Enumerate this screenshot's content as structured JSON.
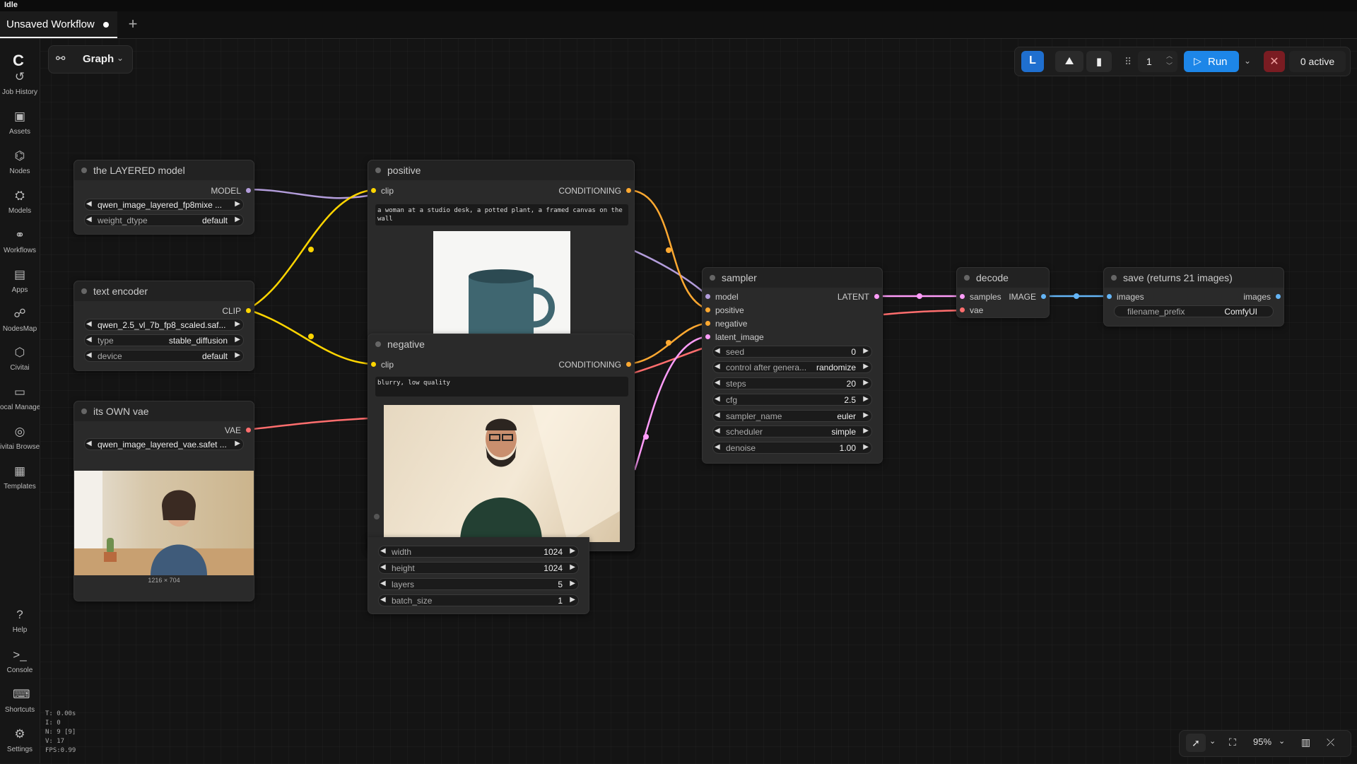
{
  "status": {
    "state": "Idle"
  },
  "tabs": [
    {
      "label": "Unsaved Workflow",
      "modified": true
    }
  ],
  "new_tab_icon": "+",
  "sidebar": {
    "logo": "C",
    "items": [
      {
        "label": "Job History",
        "icon": "↺"
      },
      {
        "label": "Assets",
        "icon": "▣"
      },
      {
        "label": "Nodes",
        "icon": "⌬"
      },
      {
        "label": "Models",
        "icon": "⛭"
      },
      {
        "label": "Workflows",
        "icon": "⚭"
      },
      {
        "label": "Apps",
        "icon": "▤"
      },
      {
        "label": "NodesMap",
        "icon": "☍"
      },
      {
        "label": "Civitai",
        "icon": "⬡"
      },
      {
        "label": "ocal Manage",
        "icon": "▭"
      },
      {
        "label": "ivitai Browse",
        "icon": "◎"
      },
      {
        "label": "Templates",
        "icon": "▦"
      }
    ],
    "bottom_items": [
      {
        "label": "Help",
        "icon": "?"
      },
      {
        "label": "Console",
        "icon": ">_"
      },
      {
        "label": "Shortcuts",
        "icon": "⌨"
      },
      {
        "label": "Settings",
        "icon": "⚙"
      }
    ]
  },
  "graph_mode": {
    "label": "Graph"
  },
  "toolbar": {
    "l_label": "L",
    "queue_count": "1",
    "run_label": "Run",
    "cancel_icon": "✕",
    "active_label": "0 active"
  },
  "nodes": {
    "model": {
      "title": "the LAYERED model",
      "output": "MODEL",
      "widgets": {
        "unet_name": "qwen_image_layered_fp8mixe ...",
        "weight_dtype_label": "weight_dtype",
        "weight_dtype": "default"
      }
    },
    "text_encoder": {
      "title": "text encoder",
      "output": "CLIP",
      "widgets": {
        "clip_name": "qwen_2.5_vl_7b_fp8_scaled.saf...",
        "type_label": "type",
        "type": "stable_diffusion",
        "device_label": "device",
        "device": "default"
      }
    },
    "vae": {
      "title": "its OWN vae",
      "output": "VAE",
      "widgets": {
        "vae_name": "qwen_image_layered_vae.safet ..."
      },
      "image_size": "1216 × 704"
    },
    "positive": {
      "title": "positive",
      "input": "clip",
      "output": "CONDITIONING",
      "text": "a woman at a studio desk, a potted plant, a framed canvas on the wall"
    },
    "negative": {
      "title": "negative",
      "input": "clip",
      "output": "CONDITIONING",
      "text": "blurry, low quality"
    },
    "latent": {
      "widgets": [
        {
          "name": "width",
          "value": "1024"
        },
        {
          "name": "height",
          "value": "1024"
        },
        {
          "name": "layers",
          "value": "5"
        },
        {
          "name": "batch_size",
          "value": "1"
        }
      ]
    },
    "sampler": {
      "title": "sampler",
      "inputs": [
        "model",
        "positive",
        "negative",
        "latent_image"
      ],
      "output": "LATENT",
      "widgets": [
        {
          "name": "seed",
          "value": "0"
        },
        {
          "name": "control after genera...",
          "value": "randomize"
        },
        {
          "name": "steps",
          "value": "20"
        },
        {
          "name": "cfg",
          "value": "2.5"
        },
        {
          "name": "sampler_name",
          "value": "euler"
        },
        {
          "name": "scheduler",
          "value": "simple"
        },
        {
          "name": "denoise",
          "value": "1.00"
        }
      ]
    },
    "decode": {
      "title": "decode",
      "inputs": [
        "samples",
        "vae"
      ],
      "output": "IMAGE"
    },
    "save": {
      "title": "save (returns 21 images)",
      "input": "images",
      "output": "images",
      "widgets": {
        "filename_prefix_label": "filename_prefix",
        "filename_prefix": "ComfyUI"
      }
    }
  },
  "canvas_controls": {
    "zoom": "95%"
  },
  "stats": [
    "T: 0.00s",
    "I: 0",
    "N: 9 [9]",
    "V: 17",
    "FPS:0.99"
  ],
  "colors": {
    "model": "#b39ddb",
    "clip": "#ffd500",
    "conditioning": "#ffa931",
    "vae": "#ff6e6e",
    "latent": "#ff9cf9",
    "image": "#64b5f6",
    "accent": "#1d86e8"
  }
}
